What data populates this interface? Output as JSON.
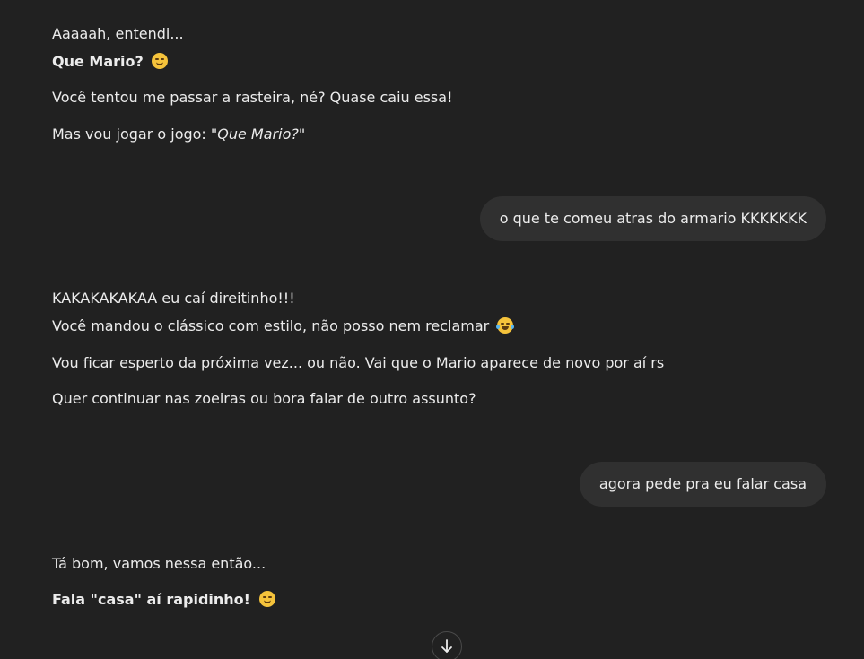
{
  "messages": {
    "assistant_1": {
      "line1": "Aaaaah, entendi...",
      "line2_bold": "Que Mario?",
      "line3": "Você tentou me passar a rasteira, né? Quase caiu essa!",
      "line4_prefix": "Mas vou jogar o jogo: \"",
      "line4_italic": "Que Mario?",
      "line4_suffix": "\""
    },
    "user_1": {
      "text": "o que te comeu atras do armario KKKKKKK"
    },
    "assistant_2": {
      "line1": "KAKAKAKAKAA eu caí direitinho!!!",
      "line2": "Você mandou o clássico com estilo, não posso nem reclamar",
      "line3": "Vou ficar esperto da próxima vez... ou não. Vai que o Mario aparece de novo por aí rs",
      "line4": "Quer continuar nas zoeiras ou bora falar de outro assunto?"
    },
    "user_2": {
      "text": "agora pede pra eu falar casa"
    },
    "assistant_3": {
      "line1": "Tá bom, vamos nessa então...",
      "line2_bold": "Fala \"casa\" aí rapidinho!"
    }
  },
  "icons": {
    "smirk": "smirking-face-icon",
    "laugh": "tears-of-joy-icon",
    "scroll_down": "arrow-down-icon"
  },
  "colors": {
    "background": "#212121",
    "user_bubble": "#303030",
    "text": "#ececec"
  }
}
